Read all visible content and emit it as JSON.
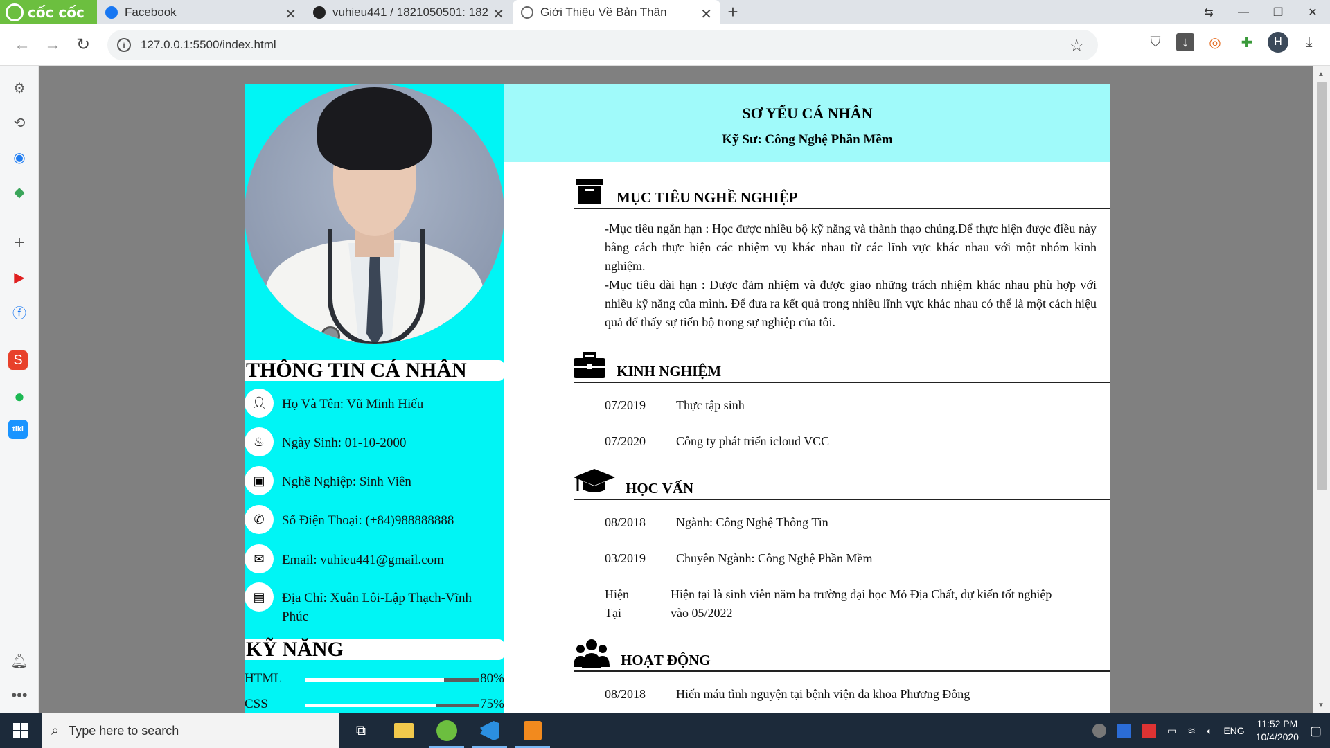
{
  "browser": {
    "brand": "cốc cốc",
    "tabs": [
      {
        "label": "Facebook",
        "active": false
      },
      {
        "label": "vuhieu441 / 1821050501: 182",
        "active": false
      },
      {
        "label": "Giới Thiệu Về Bản Thân",
        "active": true
      }
    ],
    "url": "127.0.0.1:5500/index.html"
  },
  "cv": {
    "header": {
      "title": "SƠ YẾU CÁ NHÂN",
      "subtitle": "Kỹ Sư: Công Nghệ Phần Mềm"
    },
    "personal": {
      "title": "THÔNG TIN CÁ NHÂN",
      "items": [
        {
          "icon": "user-icon",
          "text": "Họ Và Tên: Vũ Minh Hiếu"
        },
        {
          "icon": "cake-icon",
          "text": "Ngày Sinh: 01-10-2000"
        },
        {
          "icon": "briefcase-icon",
          "text": "Nghề Nghiệp: Sinh Viên"
        },
        {
          "icon": "phone-icon",
          "text": "Số Điện Thoại: (+84)988888888"
        },
        {
          "icon": "envelope-icon",
          "text": "Email: vuhieu441@gmail.com"
        },
        {
          "icon": "address-book-icon",
          "text": "Địa Chỉ: Xuân Lôi-Lập Thạch-Vĩnh Phúc"
        }
      ]
    },
    "skills": {
      "title": "KỸ NĂNG",
      "items": [
        {
          "name": "HTML",
          "percent": "80%",
          "level": 0.8
        },
        {
          "name": "CSS",
          "percent": "75%",
          "level": 0.75
        }
      ]
    },
    "objective": {
      "title": "MỤC TIÊU NGHỀ NGHIỆP",
      "short": "-Mục tiêu ngắn hạn : Học được nhiều bộ kỹ năng và thành thạo chúng.Để thực hiện được điều này bằng cách thực hiện các nhiệm vụ khác nhau từ các lĩnh vực khác nhau với một nhóm kinh nghiệm.",
      "long": "-Mục tiêu dài hạn : Được đảm nhiệm và được giao những trách nhiệm khác nhau phù hợp với nhiều kỹ năng của mình. Để đưa ra kết quả trong nhiều lĩnh vực khác nhau có thể là một cách hiệu quả để thấy sự tiến bộ trong sự nghiệp của tôi."
    },
    "experience": {
      "title": "KINH NGHIỆM",
      "rows": [
        {
          "date": "07/2019",
          "text": "Thực tập sinh"
        },
        {
          "date": "07/2020",
          "text": "Công ty phát triển icloud VCC"
        }
      ]
    },
    "education": {
      "title": "HỌC VẤN",
      "rows": [
        {
          "date": "08/2018",
          "text": "Ngành: Công Nghệ Thông Tin"
        },
        {
          "date": "03/2019",
          "text": "Chuyên Ngành: Công Nghệ Phần Mềm"
        },
        {
          "date": "Hiện Tại",
          "text": "Hiện tại là sinh viên năm ba trường đại học Mỏ Địa Chất, dự kiến tốt nghiệp vào 05/2022"
        }
      ]
    },
    "activities": {
      "title": "HOẠT ĐỘNG",
      "rows": [
        {
          "date": "08/2018",
          "text": "Hiến máu tình nguyện tại bệnh viện đa khoa Phương Đông"
        }
      ]
    }
  },
  "taskbar": {
    "search_placeholder": "Type here to search",
    "lang": "ENG",
    "time": "11:52 PM",
    "date": "10/4/2020"
  }
}
